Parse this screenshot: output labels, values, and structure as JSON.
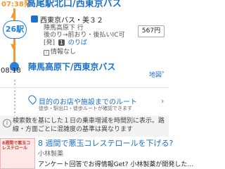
{
  "departure": {
    "time": "07:38発",
    "station": "高尾駅北口/西東京バス"
  },
  "segment": {
    "badge": "26駅",
    "bus_name": "西東京バス・美３２",
    "destination": "陣馬高原下 行",
    "seat_info": "後のり→前おり・後払いIC可",
    "platform_prefix": "[発]",
    "platform_number": "1",
    "platform_link": "のりば",
    "info_label": "情報なし",
    "fare": "567円"
  },
  "arrival": {
    "time": "08:18",
    "station": "陣馬高原下/西東京バス",
    "map_label": "地図"
  },
  "route_search": {
    "label": "目的のお店や施設までのルート",
    "sub": "徒歩・駅出口・徒歩ルートが確認できます"
  },
  "notice": {
    "text": "検索数を基にした１日の乗車増減を時間別に表示。路線・方面ごとに混雑度の基準は異なります"
  },
  "ad": {
    "image_text": "8週間で悪玉コレステロール",
    "title": "8 週間で悪玉コレステロールを下げる?",
    "sponsor": "小林製薬",
    "description": "アンケート回答でお得情報Get? 小林製薬が開発した…"
  }
}
